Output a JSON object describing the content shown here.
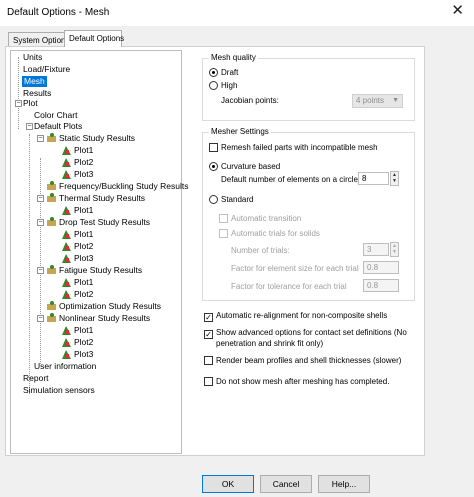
{
  "window": {
    "title": "Default Options - Mesh",
    "close_glyph": "✕"
  },
  "tabs": [
    {
      "label": "System Options"
    },
    {
      "label": "Default Options"
    }
  ],
  "tree": {
    "units": "Units",
    "load_fixture": "Load/Fixture",
    "mesh": "Mesh",
    "results": "Results",
    "plot": "Plot",
    "color_chart": "Color Chart",
    "default_plots": "Default Plots",
    "static": "Static Study Results",
    "static_plots": [
      "Plot1",
      "Plot2",
      "Plot3"
    ],
    "frequency": "Frequency/Buckling Study Results",
    "thermal": "Thermal Study Results",
    "thermal_plots": [
      "Plot1"
    ],
    "drop": "Drop Test Study Results",
    "drop_plots": [
      "Plot1",
      "Plot2",
      "Plot3"
    ],
    "fatigue": "Fatigue Study Results",
    "fatigue_plots": [
      "Plot1",
      "Plot2"
    ],
    "optimization": "Optimization Study Results",
    "nonlinear": "Nonlinear Study Results",
    "nonlinear_plots": [
      "Plot1",
      "Plot2",
      "Plot3"
    ],
    "user_information": "User information",
    "report": "Report",
    "simulation_sensors": "Simulation sensors",
    "expand_minus": "−",
    "expand_plus": "+"
  },
  "mesh_quality": {
    "label": "Mesh quality",
    "draft": "Draft",
    "high": "High",
    "selected": "Draft",
    "jacobian_label": "Jacobian points:",
    "jacobian_value": "4 points"
  },
  "mesher": {
    "label": "Mesher Settings",
    "remesh": "Remesh failed parts with incompatible mesh",
    "remesh_checked": false,
    "curvature": "Curvature based",
    "default_elements_label": "Default number of elements on a circle:",
    "default_elements_value": "8",
    "standard": "Standard",
    "auto_transition": "Automatic transition",
    "auto_trials": "Automatic trials for solids",
    "num_trials_label": "Number of trials:",
    "num_trials_value": "3",
    "factor_size_label": "Factor for element size for each trial",
    "factor_size_value": "0.8",
    "factor_tol_label": "Factor for tolerance for each trial",
    "factor_tol_value": "0.8",
    "selected": "Curvature based"
  },
  "options": {
    "auto_realign": "Automatic re-alignment for non-composite shells",
    "auto_realign_checked": true,
    "show_advanced_line1": "Show advanced options for contact set definitions (No",
    "show_advanced_line2": "penetration and shrink fit only)",
    "show_advanced_checked": true,
    "render_beam": "Render beam profiles and shell thicknesses (slower)",
    "render_beam_checked": false,
    "no_show_mesh": "Do not show mesh after meshing has completed.",
    "no_show_mesh_checked": false
  },
  "buttons": {
    "ok": "OK",
    "cancel": "Cancel",
    "help": "Help..."
  },
  "glyphs": {
    "check": "✓",
    "up": "▲",
    "down": "▼",
    "combo_arrow": "▼"
  },
  "colors": {
    "selection": "#0078d7",
    "plot_icon_green": "#2e8b2e",
    "plot_icon_red": "#d9302b"
  }
}
